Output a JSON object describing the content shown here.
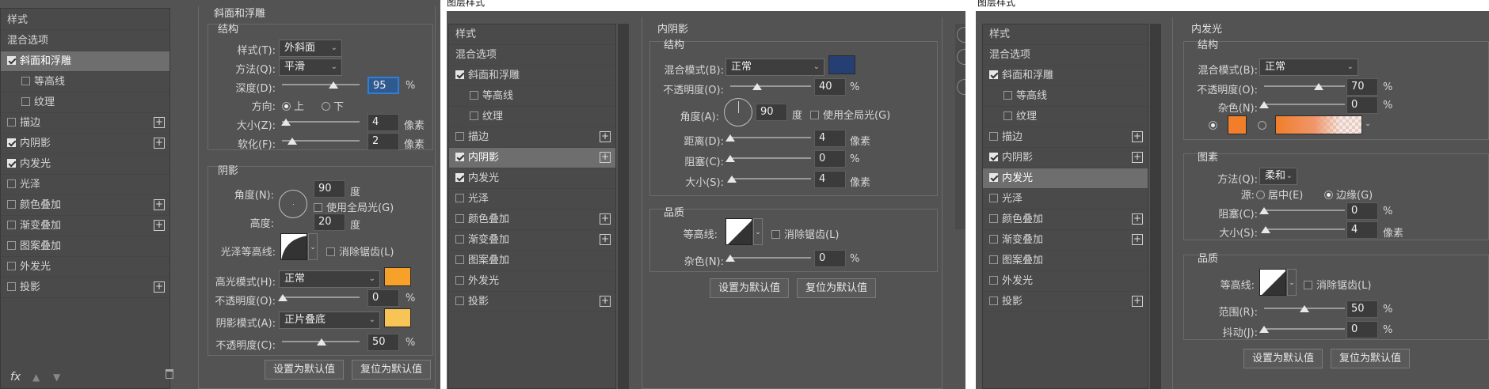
{
  "p1": {
    "sidebar": {
      "header": "样式",
      "items": [
        {
          "label": "混合选项",
          "checkbox": false,
          "checked": false,
          "plus": false,
          "sub": false,
          "selected": false
        },
        {
          "label": "斜面和浮雕",
          "checkbox": true,
          "checked": true,
          "plus": false,
          "sub": false,
          "selected": true
        },
        {
          "label": "等高线",
          "checkbox": true,
          "checked": false,
          "plus": false,
          "sub": true,
          "selected": false
        },
        {
          "label": "纹理",
          "checkbox": true,
          "checked": false,
          "plus": false,
          "sub": true,
          "selected": false
        },
        {
          "label": "描边",
          "checkbox": true,
          "checked": false,
          "plus": true,
          "sub": false,
          "selected": false
        },
        {
          "label": "内阴影",
          "checkbox": true,
          "checked": true,
          "plus": true,
          "sub": false,
          "selected": false
        },
        {
          "label": "内发光",
          "checkbox": true,
          "checked": true,
          "plus": false,
          "sub": false,
          "selected": false
        },
        {
          "label": "光泽",
          "checkbox": true,
          "checked": false,
          "plus": false,
          "sub": false,
          "selected": false
        },
        {
          "label": "颜色叠加",
          "checkbox": true,
          "checked": false,
          "plus": true,
          "sub": false,
          "selected": false
        },
        {
          "label": "渐变叠加",
          "checkbox": true,
          "checked": false,
          "plus": true,
          "sub": false,
          "selected": false
        },
        {
          "label": "图案叠加",
          "checkbox": true,
          "checked": false,
          "plus": false,
          "sub": false,
          "selected": false
        },
        {
          "label": "外发光",
          "checkbox": true,
          "checked": false,
          "plus": false,
          "sub": false,
          "selected": false
        },
        {
          "label": "投影",
          "checkbox": true,
          "checked": false,
          "plus": true,
          "sub": false,
          "selected": false
        }
      ],
      "footer_fx": "fx"
    },
    "section_title": "斜面和浮雕",
    "structure": {
      "title": "结构",
      "style_label": "样式(T):",
      "style_value": "外斜面",
      "method_label": "方法(Q):",
      "method_value": "平滑",
      "depth_label": "深度(D):",
      "depth_value": "95",
      "depth_unit": "%",
      "direction_label": "方向:",
      "dir_up": "上",
      "dir_down": "下",
      "size_label": "大小(Z):",
      "size_value": "4",
      "size_unit": "像素",
      "soften_label": "软化(F):",
      "soften_value": "2",
      "soften_unit": "像素"
    },
    "shading": {
      "title": "阴影",
      "angle_label": "角度(N):",
      "angle_value": "90",
      "angle_unit": "度",
      "global_light": "使用全局光(G)",
      "altitude_label": "高度:",
      "altitude_value": "20",
      "altitude_unit": "度",
      "gloss_label": "光泽等高线:",
      "antialias": "消除锯齿(L)",
      "highlight_label": "高光模式(H):",
      "highlight_mode": "正常",
      "highlight_color": "#f7a12b",
      "hl_opacity_label": "不透明度(O):",
      "hl_opacity": "0",
      "hl_unit": "%",
      "shadow_label": "阴影模式(A):",
      "shadow_mode": "正片叠底",
      "shadow_color": "#f8c455",
      "sh_opacity_label": "不透明度(C):",
      "sh_opacity": "50",
      "sh_unit": "%"
    },
    "buttons": {
      "make_default": "设置为默认值",
      "reset_default": "复位为默认值"
    }
  },
  "p2": {
    "window_title": "图层样式",
    "sidebar": {
      "header": "样式",
      "items": [
        {
          "label": "混合选项",
          "checkbox": false,
          "checked": false,
          "plus": false,
          "sub": false,
          "selected": false
        },
        {
          "label": "斜面和浮雕",
          "checkbox": true,
          "checked": true,
          "plus": false,
          "sub": false,
          "selected": false
        },
        {
          "label": "等高线",
          "checkbox": true,
          "checked": false,
          "plus": false,
          "sub": true,
          "selected": false
        },
        {
          "label": "纹理",
          "checkbox": true,
          "checked": false,
          "plus": false,
          "sub": true,
          "selected": false
        },
        {
          "label": "描边",
          "checkbox": true,
          "checked": false,
          "plus": true,
          "sub": false,
          "selected": false
        },
        {
          "label": "内阴影",
          "checkbox": true,
          "checked": true,
          "plus": true,
          "sub": false,
          "selected": true
        },
        {
          "label": "内发光",
          "checkbox": true,
          "checked": true,
          "plus": false,
          "sub": false,
          "selected": false
        },
        {
          "label": "光泽",
          "checkbox": true,
          "checked": false,
          "plus": false,
          "sub": false,
          "selected": false
        },
        {
          "label": "颜色叠加",
          "checkbox": true,
          "checked": false,
          "plus": true,
          "sub": false,
          "selected": false
        },
        {
          "label": "渐变叠加",
          "checkbox": true,
          "checked": false,
          "plus": true,
          "sub": false,
          "selected": false
        },
        {
          "label": "图案叠加",
          "checkbox": true,
          "checked": false,
          "plus": false,
          "sub": false,
          "selected": false
        },
        {
          "label": "外发光",
          "checkbox": true,
          "checked": false,
          "plus": false,
          "sub": false,
          "selected": false
        },
        {
          "label": "投影",
          "checkbox": true,
          "checked": false,
          "plus": true,
          "sub": false,
          "selected": false
        }
      ]
    },
    "section_title": "内阴影",
    "structure": {
      "title": "结构",
      "blend_label": "混合模式(B):",
      "blend_value": "正常",
      "blend_color": "#253f73",
      "opacity_label": "不透明度(O):",
      "opacity_value": "40",
      "opacity_unit": "%",
      "angle_label": "角度(A):",
      "angle_value": "90",
      "angle_unit": "度",
      "global_light": "使用全局光(G)",
      "distance_label": "距离(D):",
      "distance_value": "4",
      "distance_unit": "像素",
      "choke_label": "阻塞(C):",
      "choke_value": "0",
      "choke_unit": "%",
      "size_label": "大小(S):",
      "size_value": "4",
      "size_unit": "像素"
    },
    "quality": {
      "title": "品质",
      "contour_label": "等高线:",
      "antialias": "消除锯齿(L)",
      "noise_label": "杂色(N):",
      "noise_value": "0",
      "noise_unit": "%"
    },
    "buttons": {
      "make_default": "设置为默认值",
      "reset_default": "复位为默认值"
    }
  },
  "p3": {
    "window_title": "图层样式",
    "sidebar": {
      "header": "样式",
      "items": [
        {
          "label": "混合选项",
          "checkbox": false,
          "checked": false,
          "plus": false,
          "sub": false,
          "selected": false
        },
        {
          "label": "斜面和浮雕",
          "checkbox": true,
          "checked": true,
          "plus": false,
          "sub": false,
          "selected": false
        },
        {
          "label": "等高线",
          "checkbox": true,
          "checked": false,
          "plus": false,
          "sub": true,
          "selected": false
        },
        {
          "label": "纹理",
          "checkbox": true,
          "checked": false,
          "plus": false,
          "sub": true,
          "selected": false
        },
        {
          "label": "描边",
          "checkbox": true,
          "checked": false,
          "plus": true,
          "sub": false,
          "selected": false
        },
        {
          "label": "内阴影",
          "checkbox": true,
          "checked": true,
          "plus": true,
          "sub": false,
          "selected": false
        },
        {
          "label": "内发光",
          "checkbox": true,
          "checked": true,
          "plus": false,
          "sub": false,
          "selected": true
        },
        {
          "label": "光泽",
          "checkbox": true,
          "checked": false,
          "plus": false,
          "sub": false,
          "selected": false
        },
        {
          "label": "颜色叠加",
          "checkbox": true,
          "checked": false,
          "plus": true,
          "sub": false,
          "selected": false
        },
        {
          "label": "渐变叠加",
          "checkbox": true,
          "checked": false,
          "plus": true,
          "sub": false,
          "selected": false
        },
        {
          "label": "图案叠加",
          "checkbox": true,
          "checked": false,
          "plus": false,
          "sub": false,
          "selected": false
        },
        {
          "label": "外发光",
          "checkbox": true,
          "checked": false,
          "plus": false,
          "sub": false,
          "selected": false
        },
        {
          "label": "投影",
          "checkbox": true,
          "checked": false,
          "plus": true,
          "sub": false,
          "selected": false
        }
      ]
    },
    "section_title": "内发光",
    "structure": {
      "title": "结构",
      "blend_label": "混合模式(B):",
      "blend_value": "正常",
      "opacity_label": "不透明度(O):",
      "opacity_value": "70",
      "opacity_unit": "%",
      "noise_label": "杂色(N):",
      "noise_value": "0",
      "noise_unit": "%",
      "glow_color": "#f07e2a"
    },
    "elements": {
      "title": "图素",
      "technique_label": "方法(Q):",
      "technique_value": "柔和",
      "source_label": "源:",
      "src_center": "居中(E)",
      "src_edge": "边缘(G)",
      "choke_label": "阻塞(C):",
      "choke_value": "0",
      "choke_unit": "%",
      "size_label": "大小(S):",
      "size_value": "4",
      "size_unit": "像素"
    },
    "quality": {
      "title": "品质",
      "contour_label": "等高线:",
      "antialias": "消除锯齿(L)",
      "range_label": "范围(R):",
      "range_value": "50",
      "range_unit": "%",
      "jitter_label": "抖动(J):",
      "jitter_value": "0",
      "jitter_unit": "%"
    },
    "buttons": {
      "make_default": "设置为默认值",
      "reset_default": "复位为默认值"
    }
  }
}
